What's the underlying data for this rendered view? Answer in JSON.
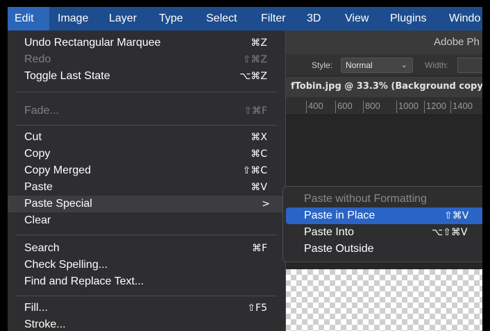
{
  "menubar": {
    "items": [
      "Edit",
      "Image",
      "Layer",
      "Type",
      "Select",
      "Filter",
      "3D",
      "View",
      "Plugins",
      "Windo"
    ],
    "active_index": 0
  },
  "app": {
    "title": "Adobe Ph",
    "options": {
      "style_label": "Style:",
      "style_value": "Normal",
      "width_label": "Width:"
    },
    "doc_tab": "fTobin.jpg @ 33.3% (Background copy",
    "ruler_ticks": [
      "400",
      "600",
      "800",
      "1000",
      "1200",
      "1400"
    ]
  },
  "edit_menu": {
    "items": [
      {
        "label": "Undo Rectangular Marquee",
        "shortcut": "⌘Z",
        "disabled": false
      },
      {
        "label": "Redo",
        "shortcut": "⇧⌘Z",
        "disabled": true
      },
      {
        "label": "Toggle Last State",
        "shortcut": "⌥⌘Z",
        "disabled": false
      },
      {
        "label": "Fade...",
        "shortcut": "⇧⌘F",
        "disabled": true
      },
      {
        "label": "Cut",
        "shortcut": "⌘X",
        "disabled": false
      },
      {
        "label": "Copy",
        "shortcut": "⌘C",
        "disabled": false
      },
      {
        "label": "Copy Merged",
        "shortcut": "⇧⌘C",
        "disabled": false
      },
      {
        "label": "Paste",
        "shortcut": "⌘V",
        "disabled": false
      },
      {
        "label": "Paste Special",
        "shortcut": ">",
        "disabled": false,
        "highlighted": true
      },
      {
        "label": "Clear",
        "shortcut": "",
        "disabled": false
      },
      {
        "label": "Search",
        "shortcut": "⌘F",
        "disabled": false
      },
      {
        "label": "Check Spelling...",
        "shortcut": "",
        "disabled": false
      },
      {
        "label": "Find and Replace Text...",
        "shortcut": "",
        "disabled": false
      },
      {
        "label": "Fill...",
        "shortcut": "⇧F5",
        "disabled": false
      },
      {
        "label": "Stroke...",
        "shortcut": "",
        "disabled": false
      }
    ]
  },
  "paste_special_menu": {
    "items": [
      {
        "label": "Paste without Formatting",
        "shortcut": "",
        "disabled": true
      },
      {
        "label": "Paste in Place",
        "shortcut": "⇧⌘V",
        "selected": true
      },
      {
        "label": "Paste Into",
        "shortcut": "⌥⇧⌘V"
      },
      {
        "label": "Paste Outside",
        "shortcut": ""
      }
    ]
  },
  "colors": {
    "menubar_bg": "#1d4d8f",
    "selection_blue": "#2a64c4",
    "menu_bg": "#2e2e31"
  }
}
